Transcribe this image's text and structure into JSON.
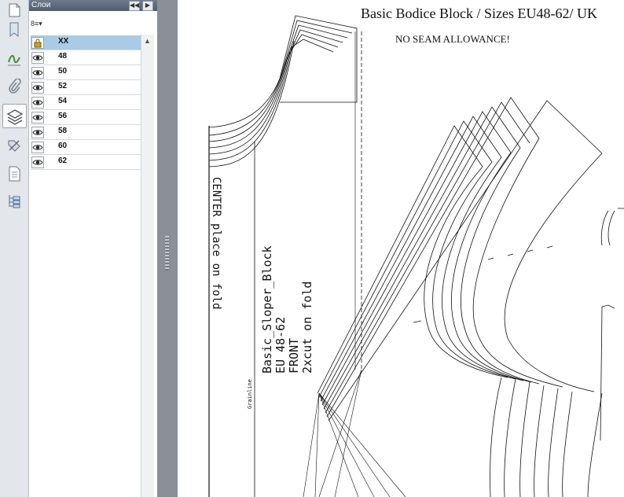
{
  "panel": {
    "title": "Слои",
    "options_label": "8≡▾",
    "collapse_label": "◀◀",
    "menu_label": "▶"
  },
  "layers": [
    {
      "name": "XX",
      "visibility": "lock-icon",
      "selected": true
    },
    {
      "name": "48",
      "visibility": "eye-icon",
      "selected": false
    },
    {
      "name": "50",
      "visibility": "eye-icon",
      "selected": false
    },
    {
      "name": "52",
      "visibility": "eye-icon",
      "selected": false
    },
    {
      "name": "54",
      "visibility": "eye-icon",
      "selected": false
    },
    {
      "name": "56",
      "visibility": "eye-icon",
      "selected": false
    },
    {
      "name": "58",
      "visibility": "eye-icon",
      "selected": false
    },
    {
      "name": "60",
      "visibility": "eye-icon",
      "selected": false
    },
    {
      "name": "62",
      "visibility": "eye-icon",
      "selected": false
    }
  ],
  "toolbar": {
    "tools": [
      "page-thumbnails-icon",
      "bookmark-icon",
      "signature-icon",
      "attachment-icon",
      "layers-icon",
      "tags-icon",
      "content-icon",
      "model-tree-icon"
    ],
    "active_tool": "layers-icon"
  },
  "document": {
    "title": "Basic Bodice Block / Sizes EU48-62/ UK",
    "note": "NO SEAM ALLOWANCE!",
    "center_label": "CENTER place on fold",
    "grainline_label": "Grainline",
    "piece_name": "Basic_Sloper_Block",
    "piece_sizes": "EU 48-62",
    "piece_part": "FRONT",
    "piece_cut": "2xcut on fold"
  },
  "colors": {
    "selected_row": "#a9cbe6",
    "panel_header": "#5d6a7a",
    "splitter": "#8b9097"
  }
}
